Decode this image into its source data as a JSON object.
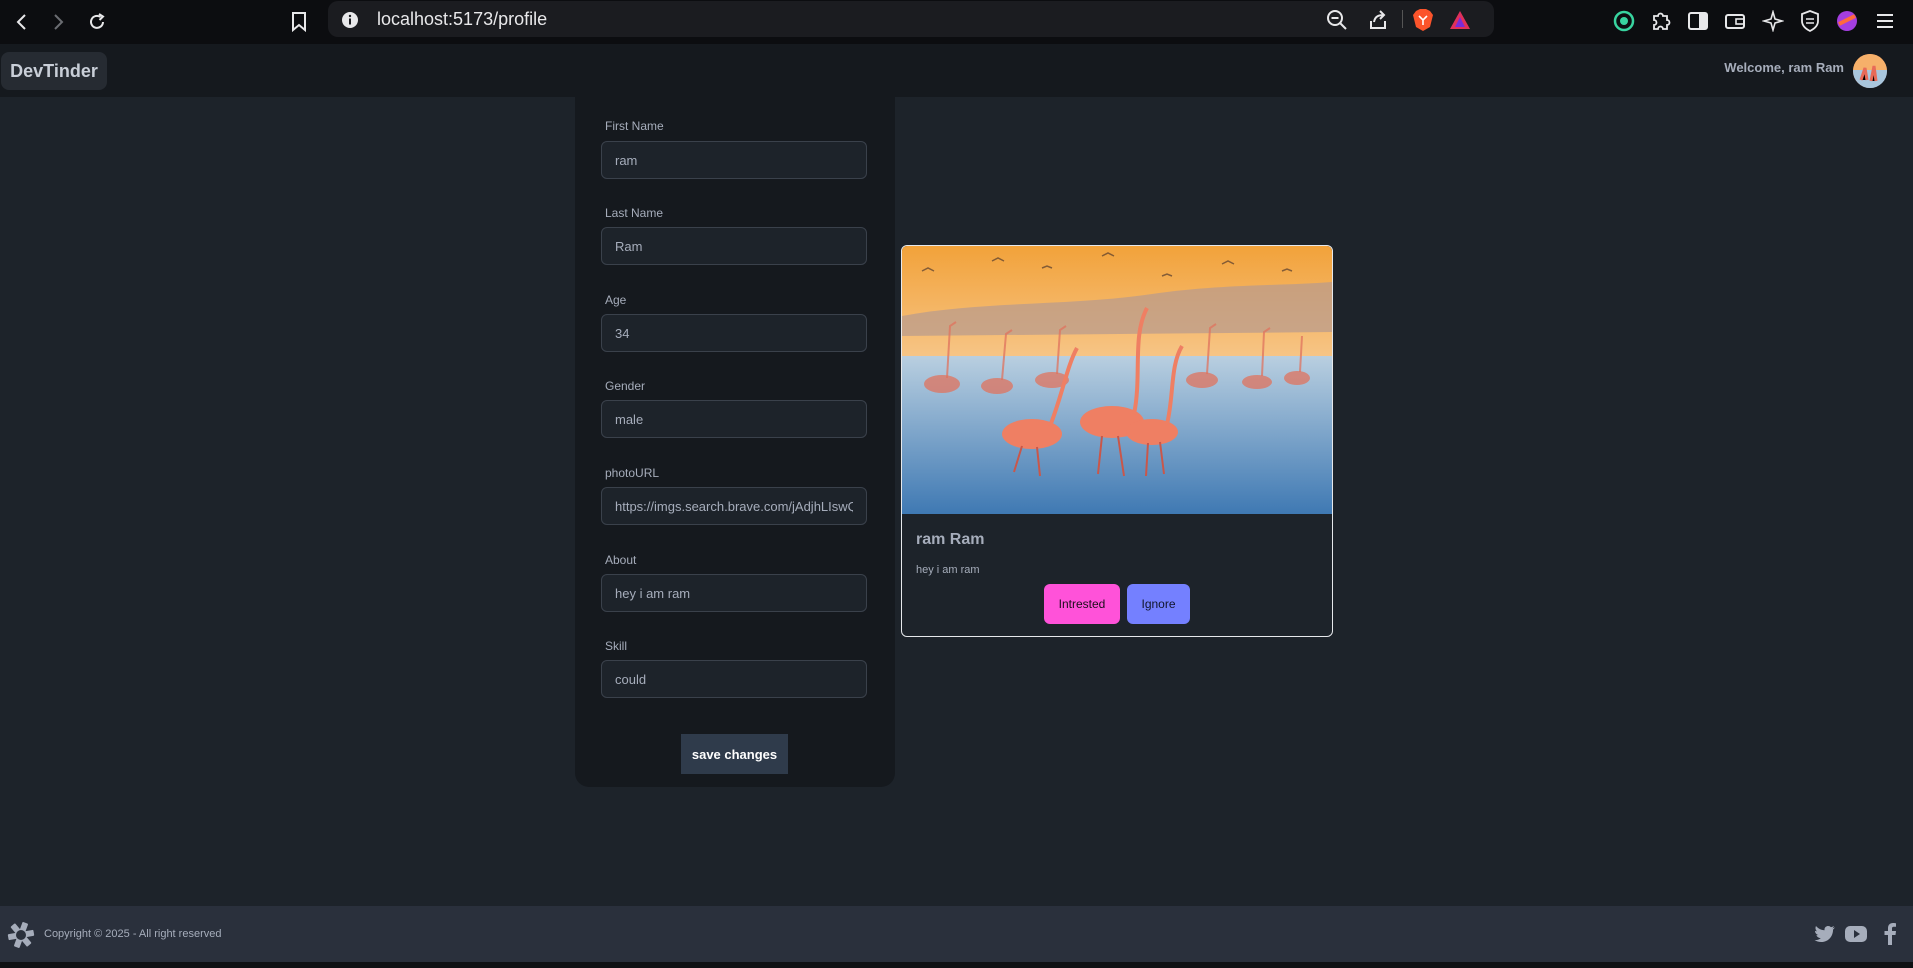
{
  "browser": {
    "url": "localhost:5173/profile"
  },
  "navbar": {
    "brand": "DevTinder",
    "welcome": "Welcome, ram Ram"
  },
  "form": {
    "fields": [
      {
        "label": "First Name",
        "value": "ram"
      },
      {
        "label": "Last Name",
        "value": "Ram"
      },
      {
        "label": "Age",
        "value": "34"
      },
      {
        "label": "Gender",
        "value": "male"
      },
      {
        "label": "photoURL",
        "value": "https://imgs.search.brave.com/jAdjhLIswQ"
      },
      {
        "label": "About",
        "value": "hey i am ram"
      },
      {
        "label": "Skill",
        "value": "could"
      }
    ],
    "save_label": "save changes"
  },
  "preview": {
    "name": "ram Ram",
    "about": "hey i am ram",
    "interested_label": "Intrested",
    "ignore_label": "Ignore",
    "colors": {
      "interested": "#ff52d9",
      "ignore": "#7480ff"
    }
  },
  "footer": {
    "copyright": "Copyright © 2025 - All right reserved",
    "social_icons": [
      "twitter-icon",
      "youtube-icon",
      "facebook-icon"
    ]
  }
}
